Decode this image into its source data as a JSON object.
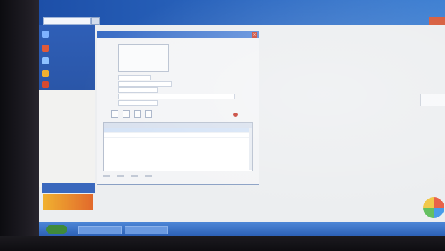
{
  "topbar": {
    "brand": "",
    "links": [
      "",
      "",
      "",
      ""
    ]
  },
  "sidebar": {
    "items": [
      {
        "label": "",
        "icon": "folder-icon",
        "color": "#7fb2ff"
      },
      {
        "label": "",
        "icon": "mail-icon",
        "color": "#e05a3a"
      },
      {
        "label": "",
        "icon": "users-icon",
        "color": "#8fc1ff"
      },
      {
        "label": "",
        "icon": "chart-icon",
        "color": "#f0b030"
      },
      {
        "label": "",
        "icon": "settings-icon",
        "color": "#d64a32"
      }
    ],
    "links": [
      "",
      "",
      "",
      "",
      "",
      "",
      "",
      "",
      ""
    ],
    "bottom_label": "",
    "promo_label": ""
  },
  "dialog": {
    "title": "",
    "close_label": "×",
    "options": [
      "",
      "",
      ""
    ],
    "fields": [
      {
        "label": "",
        "value": ""
      },
      {
        "label": "",
        "value": ""
      },
      {
        "label": "",
        "value": ""
      },
      {
        "label": "",
        "value": ""
      },
      {
        "label": "",
        "value": ""
      }
    ],
    "toolbar": [
      "",
      "",
      "",
      ""
    ],
    "status": "",
    "grid": {
      "columns": [
        "",
        "",
        ""
      ],
      "rows": [
        [
          "",
          "",
          ""
        ],
        [
          "",
          "",
          ""
        ]
      ]
    },
    "footer": [
      "",
      "",
      "",
      ""
    ]
  },
  "right_button": "",
  "taskbar": {
    "tray": ""
  },
  "colors": {
    "accent": "#2d6bc4",
    "close": "#cc4b3a",
    "link": "#c0432a"
  }
}
